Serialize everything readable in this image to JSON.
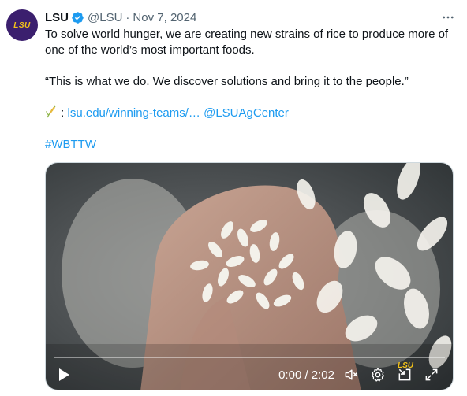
{
  "author": {
    "name": "LSU",
    "avatar_text": "LSU",
    "handle": "@LSU",
    "separator": "·",
    "date": "Nov 7, 2024",
    "verified": true
  },
  "post": {
    "line1": "To solve world hunger, we are creating new strains of rice to produce more of one of the world’s most important foods.",
    "quote": "“This is what we do. We discover solutions and bring it to the people.”",
    "emoji_icon": "rice-plant-icon",
    "link_separator": ":",
    "link_text": "lsu.edu/winning-teams/…",
    "mention": "@LSUAgCenter",
    "hashtag": "#WBTTW"
  },
  "video": {
    "time": "0:00 / 2:02",
    "progress": 0,
    "watermark": "LSU"
  },
  "colors": {
    "link": "#1d9bf0",
    "brand_purple": "#3b1f6e",
    "brand_gold": "#f5c318",
    "secondary_text": "#536471"
  }
}
